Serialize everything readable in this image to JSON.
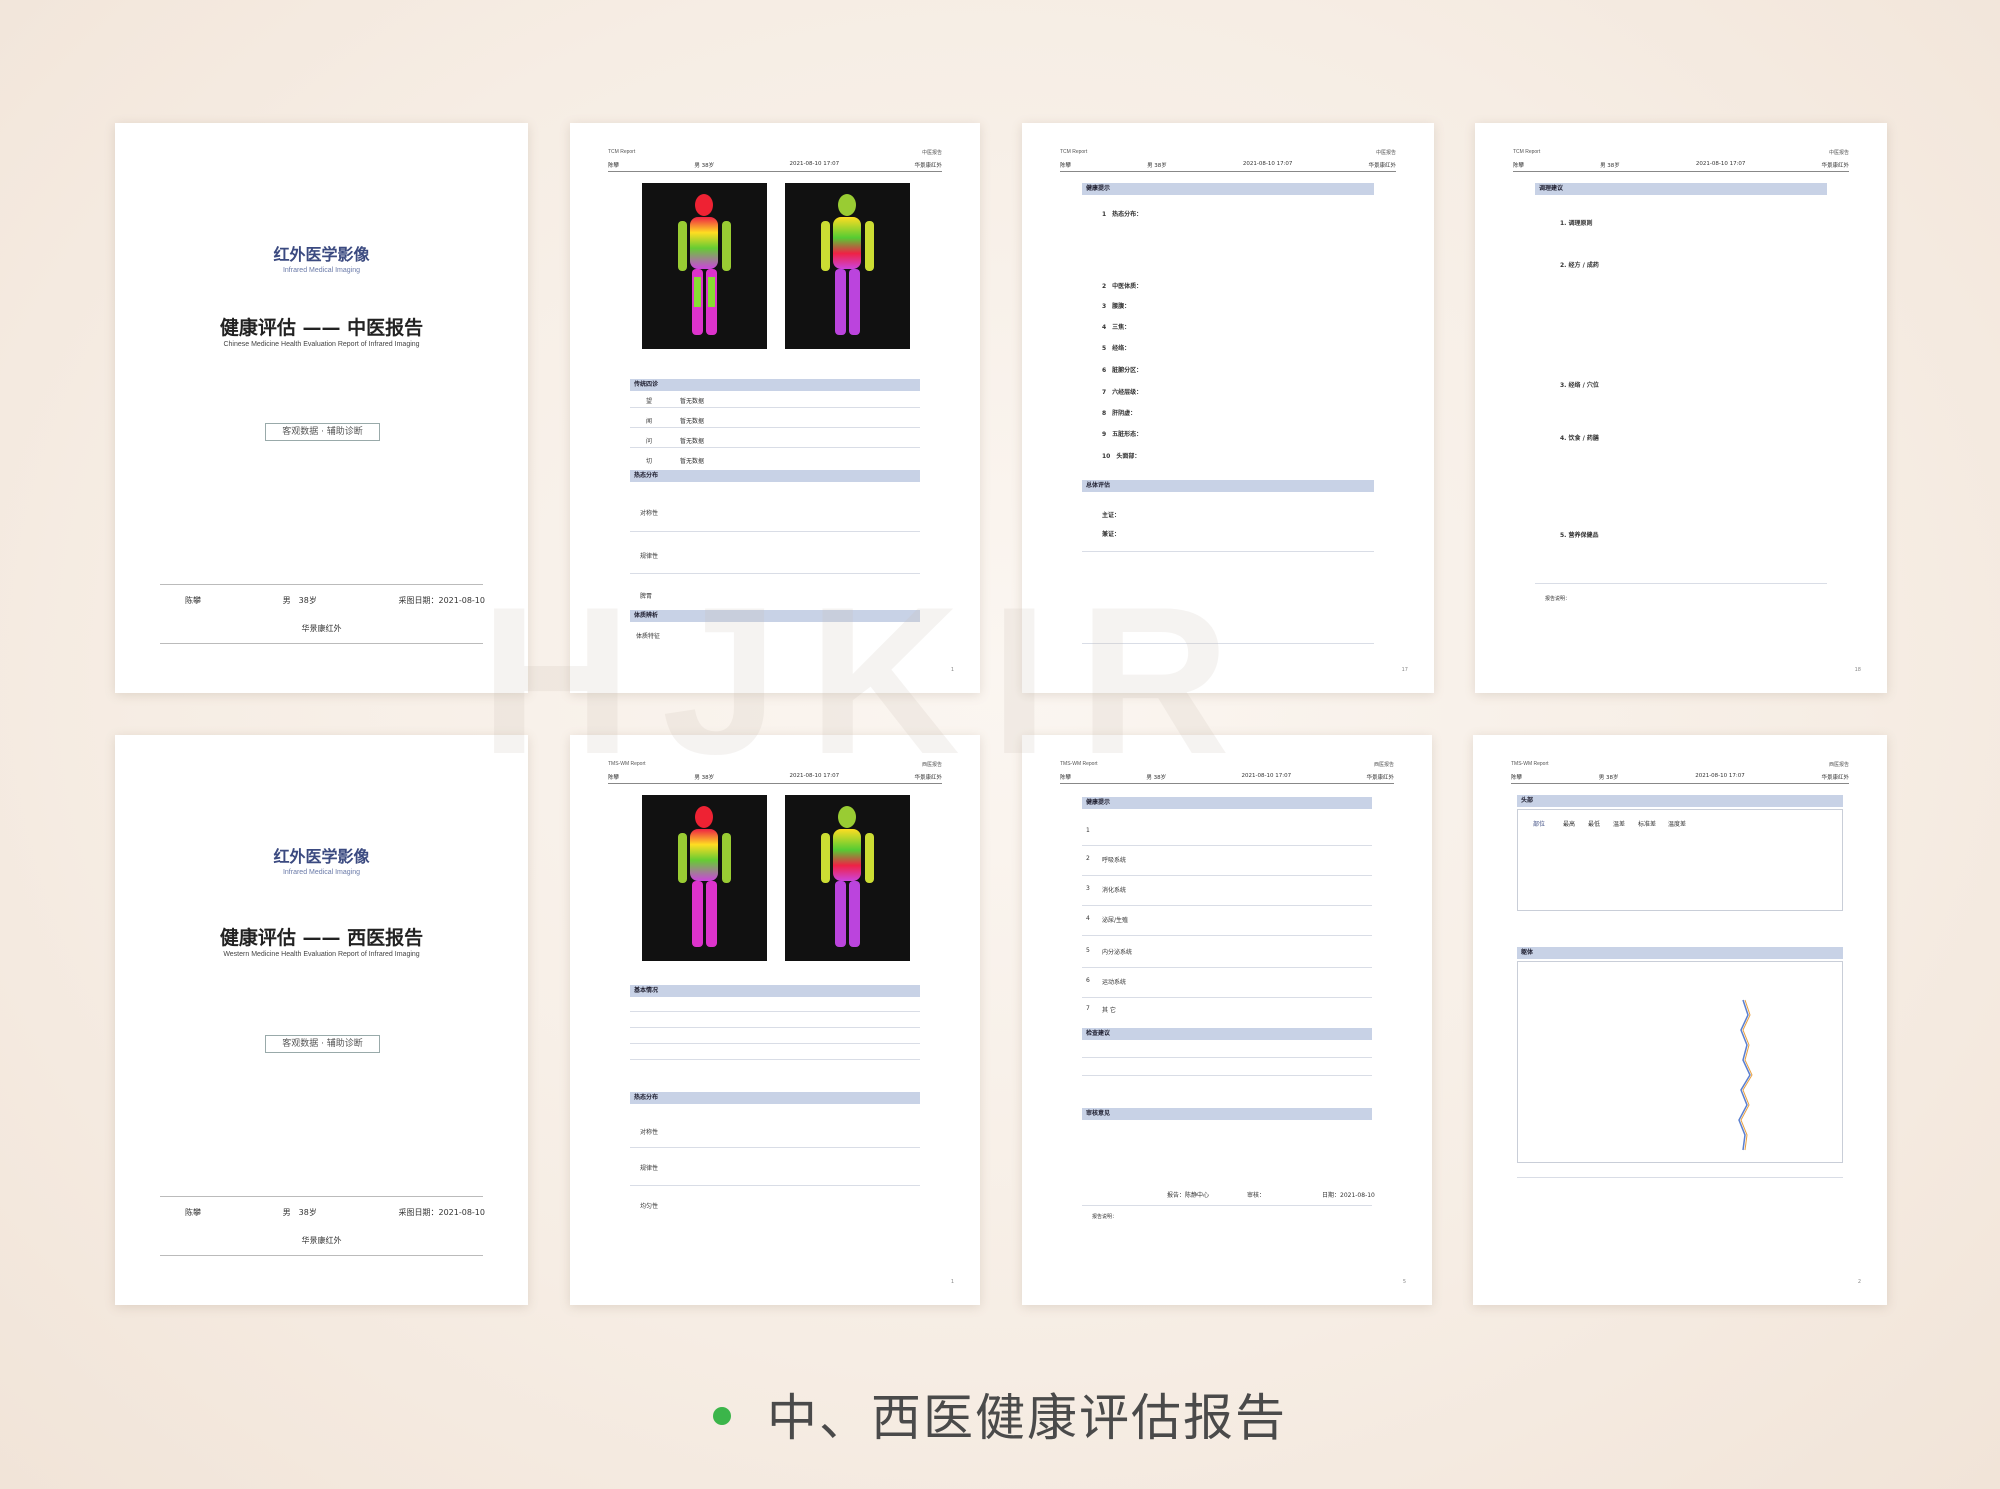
{
  "colors": {
    "accent_blue": "#3b4a80",
    "section_bar": "#c8d2e6",
    "caption_dot": "#3bb54a",
    "background": "#f6ede4"
  },
  "caption": "中、西医健康评估报告",
  "cover_tcm": {
    "brand_cn": "红外医学影像",
    "brand_en": "Infrared Medical Imaging",
    "title": "健康评估 —— 中医报告",
    "subtitle": "Chinese Medicine Health Evaluation Report of Infrared Imaging",
    "stamp": "客观数据 · 辅助诊断",
    "name": "陈攀",
    "gender_age": "男　38岁",
    "date": "采图日期：2021-08-10",
    "org": "华景康红外"
  },
  "cover_wm": {
    "brand_cn": "红外医学影像",
    "brand_en": "Infrared Medical Imaging",
    "title": "健康评估 —— 西医报告",
    "subtitle": "Western Medicine Health Evaluation Report of Infrared Imaging",
    "stamp": "客观数据 · 辅助诊断",
    "name": "陈攀",
    "gender_age": "男　38岁",
    "date": "采图日期：2021-08-10",
    "org": "华景康红外"
  },
  "page_tcm1": {
    "tag": "TCM Report",
    "tag_right": "中医报告",
    "hdr_name": "陈攀",
    "hdr_gender": "男 38岁",
    "hdr_date": "2021-08-10 17:07",
    "hdr_org": "华景康红外",
    "sec1": "传统四诊",
    "rows1": [
      "望",
      "闻",
      "问",
      "切"
    ],
    "row_val": "暂无数据",
    "sec2": "热态分布",
    "sec2_rows": [
      "对称性",
      "规律性",
      "脾胃"
    ],
    "sec3": "体质辨析",
    "sec3_row": "体质特征"
  },
  "page_tcm2": {
    "tag": "TCM Report",
    "tag_right": "中医报告",
    "sec1": "健康提示",
    "items": [
      "1　热态分布：",
      "2　中医体质：",
      "3　腰腹：",
      "4　三焦：",
      "5　经络：",
      "6　脏腑分区：",
      "7　六经层级：",
      "8　肝阴虚：",
      "9　五脏形态：",
      "10　头面部："
    ],
    "sec2": "总体评估",
    "main": "主证：",
    "sub": "兼证："
  },
  "page_tcm3": {
    "tag": "TCM Report",
    "tag_right": "中医报告",
    "sec1": "调理建议",
    "items": [
      "1. 调理原则",
      "2. 经方 / 成药",
      "3. 经络 / 穴位",
      "4. 饮食 / 药膳",
      "5. 营养保健品"
    ],
    "note": "报告说明："
  },
  "page_wm1": {
    "tag": "TMS-WM Report",
    "tag_right": "西医报告",
    "hdr_name": "陈攀",
    "hdr_gender": "男 38岁",
    "hdr_date": "2021-08-10 17:07",
    "hdr_org": "华景康红外",
    "sec1": "基本情况",
    "sec2": "热态分布",
    "sec2_rows": [
      "对称性",
      "规律性",
      "均匀性"
    ]
  },
  "page_wm2": {
    "tag": "TMS-WM Report",
    "tag_right": "西医报告",
    "sec1": "健康提示",
    "rows": [
      "呼吸系统",
      "消化系统",
      "泌尿/生殖",
      "内分泌系统",
      "运动系统",
      "其 它"
    ],
    "sec2": "检查建议",
    "sec3": "审核意见",
    "sign": "报告：陈静中心",
    "review": "审核：",
    "date": "日期：2021-08-10",
    "note": "报告说明："
  },
  "page_wm3": {
    "tag": "TMS-WM Report",
    "tag_right": "西医报告",
    "sec1": "头部",
    "sec2": "躯体",
    "cols": [
      "部位",
      "最高",
      "最低",
      "温差",
      "标准差",
      "温度差"
    ]
  }
}
